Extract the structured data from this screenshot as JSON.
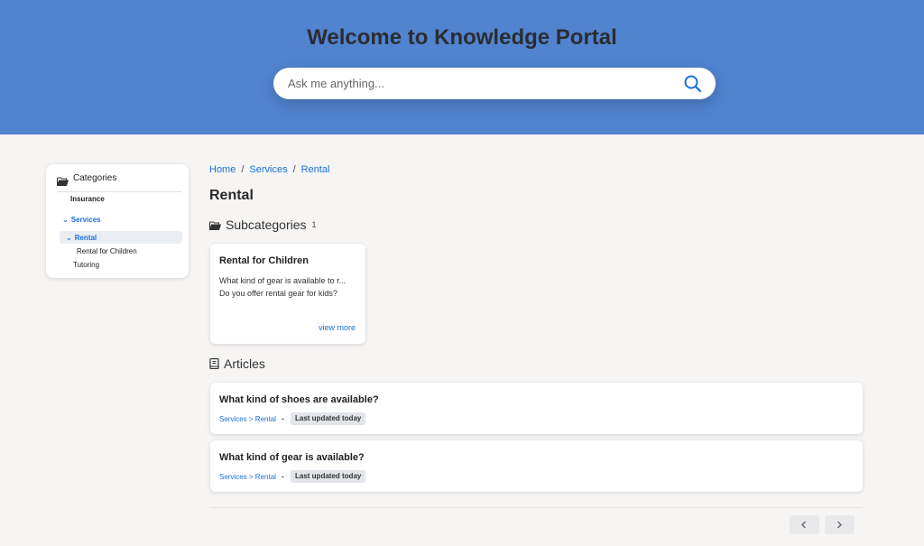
{
  "header": {
    "title": "Welcome to Knowledge Portal",
    "search_placeholder": "Ask me anything..."
  },
  "sidebar": {
    "heading": "Categories",
    "items": [
      {
        "label": "Insurance"
      },
      {
        "label": "Services"
      },
      {
        "label": "Rental"
      },
      {
        "label": "Rental for Children"
      },
      {
        "label": "Tutoring"
      }
    ]
  },
  "breadcrumb": [
    "Home",
    "Services",
    "Rental"
  ],
  "breadcrumb_separator": "/",
  "page_title": "Rental",
  "subcategories": {
    "heading": "Subcategories",
    "count": "1",
    "cards": [
      {
        "title": "Rental for Children",
        "lines": [
          "What kind of gear is available to r...",
          "Do you offer rental gear for kids?"
        ],
        "link": "view more"
      }
    ]
  },
  "articles": {
    "heading": "Articles",
    "items": [
      {
        "title": "What kind of shoes are available?",
        "path": "Services > Rental",
        "separator": "•",
        "badge": "Last updated today"
      },
      {
        "title": "What kind of gear is available?",
        "path": "Services > Rental",
        "separator": "•",
        "badge": "Last updated today"
      }
    ]
  },
  "icons": {
    "search": "search-icon",
    "folder": "folder-open-icon",
    "book": "book-icon",
    "prev": "chevron-left-icon",
    "next": "chevron-right-icon",
    "expand": "chevron-down-icon"
  },
  "colors": {
    "header_bg": "#5183cf",
    "link": "#1a6fe0",
    "page_bg": "#f6f5f4"
  }
}
